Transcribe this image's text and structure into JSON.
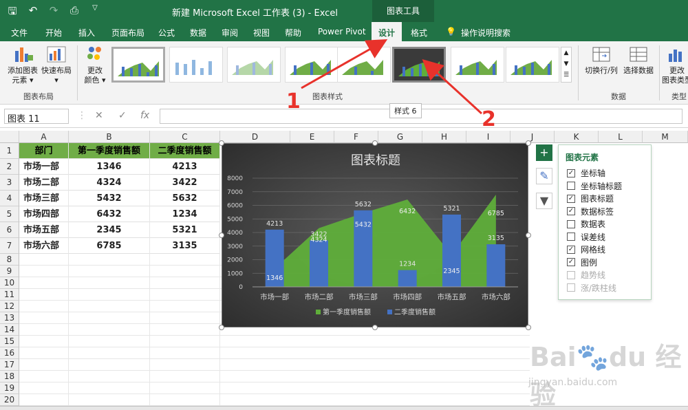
{
  "titlebar": {
    "doc_title": "新建 Microsoft Excel 工作表 (3)  -  Excel",
    "tools_tab": "图表工具"
  },
  "tabs": [
    "文件",
    "开始",
    "插入",
    "页面布局",
    "公式",
    "数据",
    "审阅",
    "视图",
    "帮助",
    "Power Pivot",
    "设计",
    "格式",
    "操作说明搜索"
  ],
  "ribbon": {
    "add_element_1": "添加图表",
    "add_element_2": "元素 ▾",
    "quick_layout_1": "快速布局",
    "quick_layout_2": "▾",
    "change_colors_1": "更改",
    "change_colors_2": "颜色 ▾",
    "group_layout": "图表布局",
    "group_styles": "图表样式",
    "switch_rowcol": "切换行/列",
    "select_data": "选择数据",
    "group_data": "数据",
    "change_type_1": "更改",
    "change_type_2": "图表类型",
    "group_type": "类型"
  },
  "tooltip": "样式 6",
  "formula_bar": {
    "name_box": "图表 11",
    "fx": "fx"
  },
  "columns": [
    "A",
    "B",
    "C",
    "D",
    "E",
    "F",
    "G",
    "H",
    "I",
    "J",
    "K",
    "L",
    "M"
  ],
  "rows": [
    "1",
    "2",
    "3",
    "4",
    "5",
    "6",
    "7",
    "8",
    "9",
    "10",
    "11",
    "12",
    "13",
    "14",
    "15",
    "16",
    "17",
    "18",
    "19",
    "20"
  ],
  "table": {
    "headers": [
      "部门",
      "第一季度销售额",
      "二季度销售额"
    ],
    "rows": [
      [
        "市场一部",
        "1346",
        "4213"
      ],
      [
        "市场二部",
        "4324",
        "3422"
      ],
      [
        "市场三部",
        "5432",
        "5632"
      ],
      [
        "市场四部",
        "6432",
        "1234"
      ],
      [
        "市场五部",
        "2345",
        "5321"
      ],
      [
        "市场六部",
        "6785",
        "3135"
      ]
    ]
  },
  "chart_data": {
    "type": "bar",
    "title": "图表标题",
    "categories": [
      "市场一部",
      "市场二部",
      "市场三部",
      "市场四部",
      "市场五部",
      "市场六部"
    ],
    "series": [
      {
        "name": "第一季度销售额",
        "type": "area",
        "values": [
          1346,
          4324,
          5432,
          6432,
          2345,
          6785
        ],
        "color": "#5fae3a"
      },
      {
        "name": "二季度销售额",
        "type": "bar",
        "values": [
          4213,
          3422,
          5632,
          1234,
          5321,
          3135
        ],
        "color": "#4472c4"
      }
    ],
    "ylim": [
      0,
      8000
    ],
    "yticks": [
      "0",
      "1000",
      "2000",
      "3000",
      "4000",
      "5000",
      "6000",
      "7000",
      "8000"
    ],
    "legend": "bottom",
    "grid": true
  },
  "panel": {
    "title": "图表元素",
    "options": [
      {
        "label": "坐标轴",
        "checked": true,
        "enabled": true
      },
      {
        "label": "坐标轴标题",
        "checked": false,
        "enabled": true
      },
      {
        "label": "图表标题",
        "checked": true,
        "enabled": true
      },
      {
        "label": "数据标签",
        "checked": true,
        "enabled": true
      },
      {
        "label": "数据表",
        "checked": false,
        "enabled": true
      },
      {
        "label": "误差线",
        "checked": false,
        "enabled": true
      },
      {
        "label": "网格线",
        "checked": true,
        "enabled": true
      },
      {
        "label": "图例",
        "checked": true,
        "enabled": true
      },
      {
        "label": "趋势线",
        "checked": false,
        "enabled": false
      },
      {
        "label": "涨/跌柱线",
        "checked": false,
        "enabled": false
      }
    ]
  },
  "annotations": {
    "one": "1",
    "two": "2"
  },
  "watermark": {
    "brand": "Bai du 经验",
    "url": "jingyan.baidu.com"
  },
  "colors": {
    "excel_green": "#217346",
    "header_green": "#70ad47",
    "arrow_red": "#e8322b"
  }
}
